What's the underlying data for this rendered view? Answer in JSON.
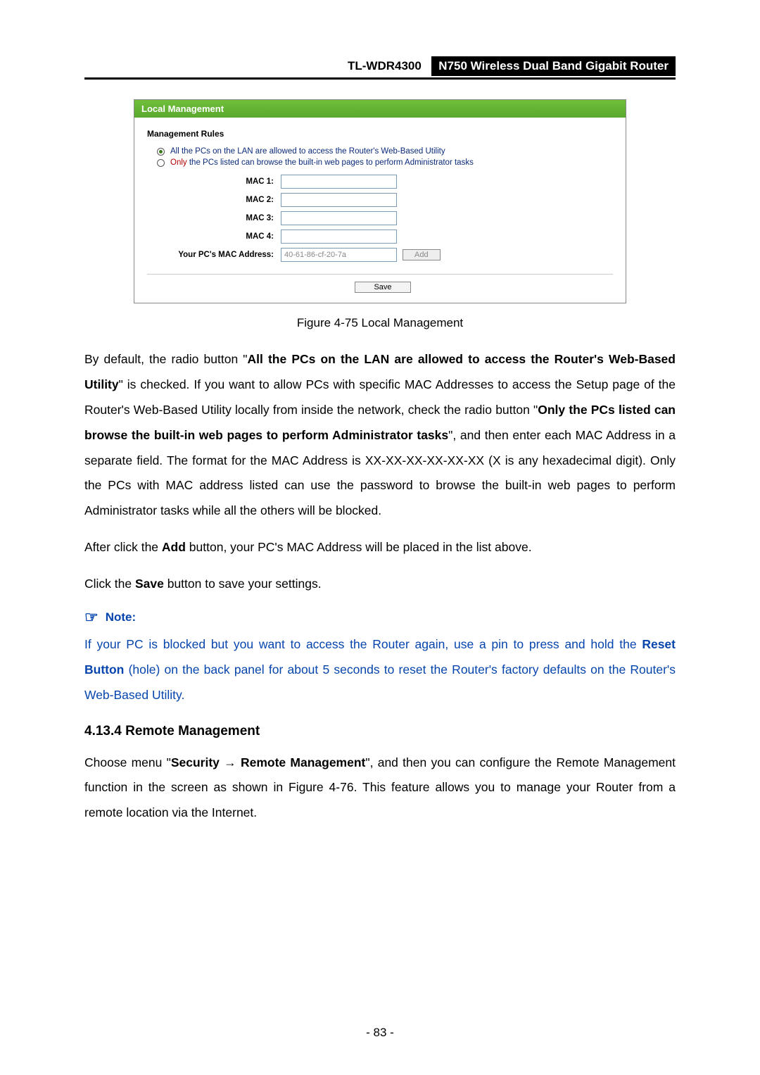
{
  "header": {
    "model": "TL-WDR4300",
    "device": "N750 Wireless Dual Band Gigabit Router"
  },
  "screenshot": {
    "title": "Local Management",
    "rules_heading": "Management Rules",
    "radio_all": "All the PCs on the LAN are allowed to access the Router's Web-Based Utility",
    "radio_only_word": "Only",
    "radio_only_rest": " the PCs listed can browse the built-in web pages to perform Administrator tasks",
    "mac_labels": {
      "m1": "MAC 1:",
      "m2": "MAC 2:",
      "m3": "MAC 3:",
      "m4": "MAC 4:"
    },
    "pc_mac_label": "Your PC's MAC Address:",
    "pc_mac_value": "40-61-86-cf-20-7a",
    "add_label": "Add",
    "save_label": "Save"
  },
  "figure_caption": "Figure 4-75 Local Management",
  "para1": {
    "t1": "By default, the radio button \"",
    "b1": "All the PCs on the LAN are allowed to access the Router's Web-Based Utility",
    "t2": "\" is checked. If you want to allow PCs with specific MAC Addresses to access the Setup page of the Router's Web-Based Utility locally from inside the network, check the radio button \"",
    "b2": "Only the PCs listed can browse the built-in web pages to perform Administrator tasks",
    "t3": "\", and then enter each MAC Address in a separate field. The format for the MAC Address is XX-XX-XX-XX-XX-XX (X is any hexadecimal digit). Only the PCs with MAC address listed can use the password to browse the built-in web pages to perform Administrator tasks while all the others will be blocked."
  },
  "para2": {
    "t1": "After click the ",
    "b1": "Add",
    "t2": " button, your PC's MAC Address will be placed in the list above."
  },
  "para3": {
    "t1": "Click the ",
    "b1": "Save",
    "t2": " button to save your settings."
  },
  "note_label": "Note:",
  "note_body": {
    "t1": "If your PC is blocked but you want to access the Router again, use a pin to press and hold the ",
    "b1": "Reset Button",
    "t2": " (hole) on the back panel for about 5 seconds to reset the Router's factory defaults on the Router's Web-Based Utility."
  },
  "section_heading": "4.13.4  Remote Management",
  "para4": {
    "t1": "Choose menu \"",
    "b1": "Security",
    "arrow": " → ",
    "b2": "Remote Management",
    "t2": "\", and then you can configure the Remote Management function in the screen as shown in Figure 4-76. This feature allows you to manage your Router from a remote location via the Internet."
  },
  "page_number": "- 83 -"
}
